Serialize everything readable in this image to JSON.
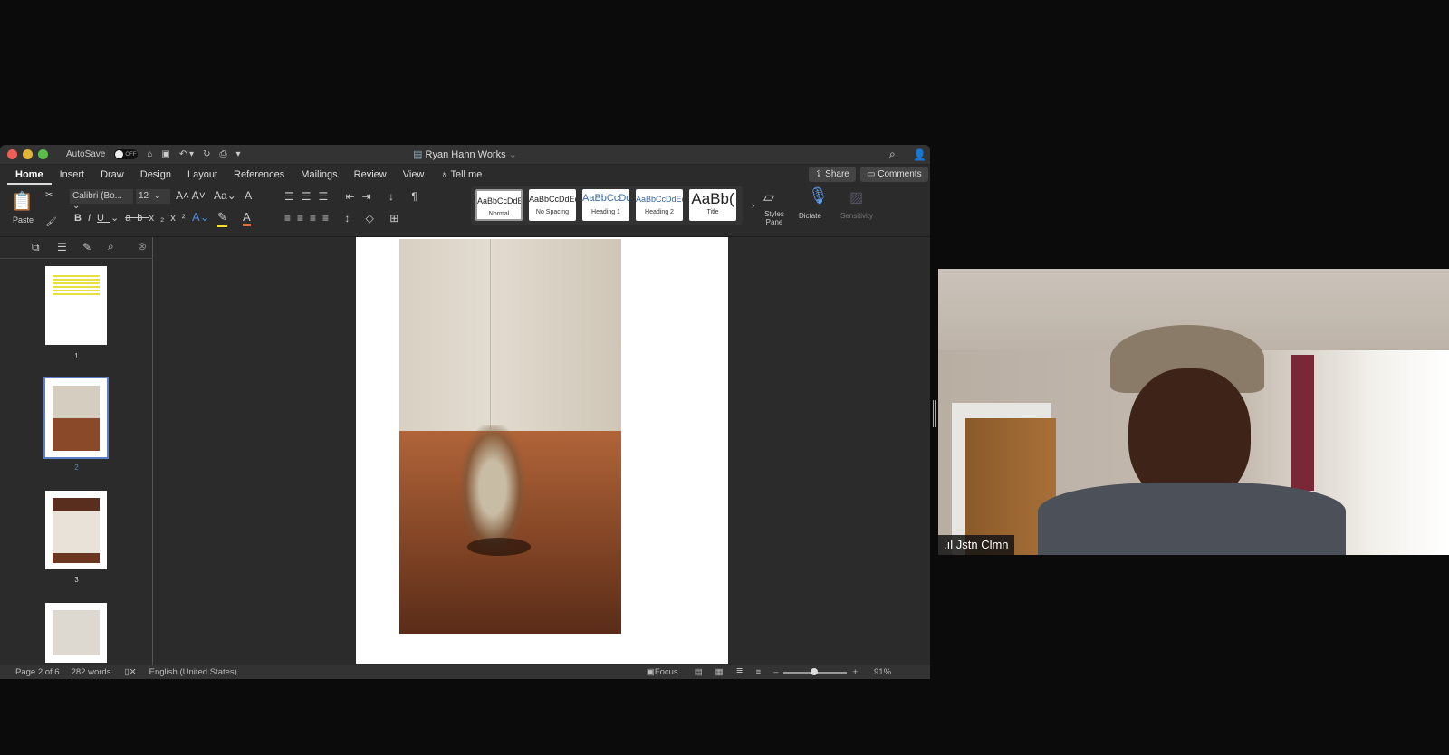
{
  "window": {
    "title": "Ryan Hahn Works",
    "autosave_label": "AutoSave",
    "autosave_state": "OFF"
  },
  "tabs": [
    "Home",
    "Insert",
    "Draw",
    "Design",
    "Layout",
    "References",
    "Mailings",
    "Review",
    "View"
  ],
  "tell_me": "Tell me",
  "share": "Share",
  "comments": "Comments",
  "ribbon": {
    "paste": "Paste",
    "font": "Calibri (Bo...",
    "size": "12",
    "styles": [
      {
        "sample": "AaBbCcDdEe",
        "label": "Normal"
      },
      {
        "sample": "AaBbCcDdEe",
        "label": "No Spacing"
      },
      {
        "sample": "AaBbCcDc",
        "label": "Heading 1"
      },
      {
        "sample": "AaBbCcDdEe",
        "label": "Heading 2"
      },
      {
        "sample": "AaBb(",
        "label": "Title"
      }
    ],
    "styles_pane": "Styles Pane",
    "dictate": "Dictate",
    "sensitivity": "Sensitivity"
  },
  "thumbnails": [
    "1",
    "2",
    "3"
  ],
  "status": {
    "page": "Page 2 of 6",
    "words": "282 words",
    "language": "English (United States)",
    "focus": "Focus",
    "zoom": "91%"
  },
  "video": {
    "participant": "Jstn Clmn"
  }
}
